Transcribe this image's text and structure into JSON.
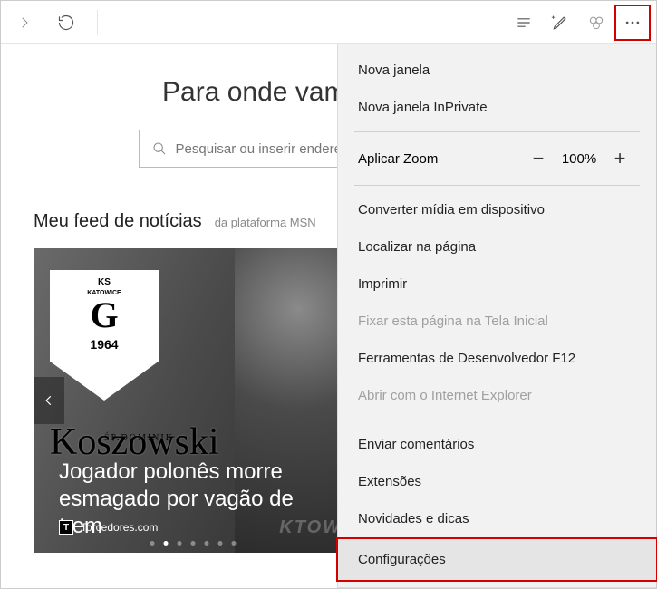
{
  "toolbar": {
    "forward_icon": "forward-icon",
    "refresh_icon": "refresh-icon"
  },
  "page": {
    "headline": "Para onde vamos a seguir?",
    "search_placeholder": "Pesquisar ou inserir endereço da Web"
  },
  "feed": {
    "title": "Meu feed de notícias",
    "subtitle": "da plataforma MSN"
  },
  "card": {
    "crest_top": "KS",
    "crest_sub": "KATOWICE",
    "crest_letter": "G",
    "crest_year": "1964",
    "script": "Koszowski",
    "sp": "ŚP.DOMINIK",
    "headline": "Jogador polonês morre esmagado por vagão de trem",
    "source": "Torcedores.com",
    "ktw": "KTOW"
  },
  "menu": {
    "new_window": "Nova janela",
    "new_inprivate": "Nova janela InPrivate",
    "zoom_label": "Aplicar Zoom",
    "zoom_value": "100%",
    "cast": "Converter mídia em dispositivo",
    "find": "Localizar na página",
    "print": "Imprimir",
    "pin": "Fixar esta página na Tela Inicial",
    "devtools": "Ferramentas de Desenvolvedor F12",
    "open_ie": "Abrir com o Internet Explorer",
    "feedback": "Enviar comentários",
    "extensions": "Extensões",
    "whatsnew": "Novidades e dicas",
    "settings": "Configurações"
  }
}
